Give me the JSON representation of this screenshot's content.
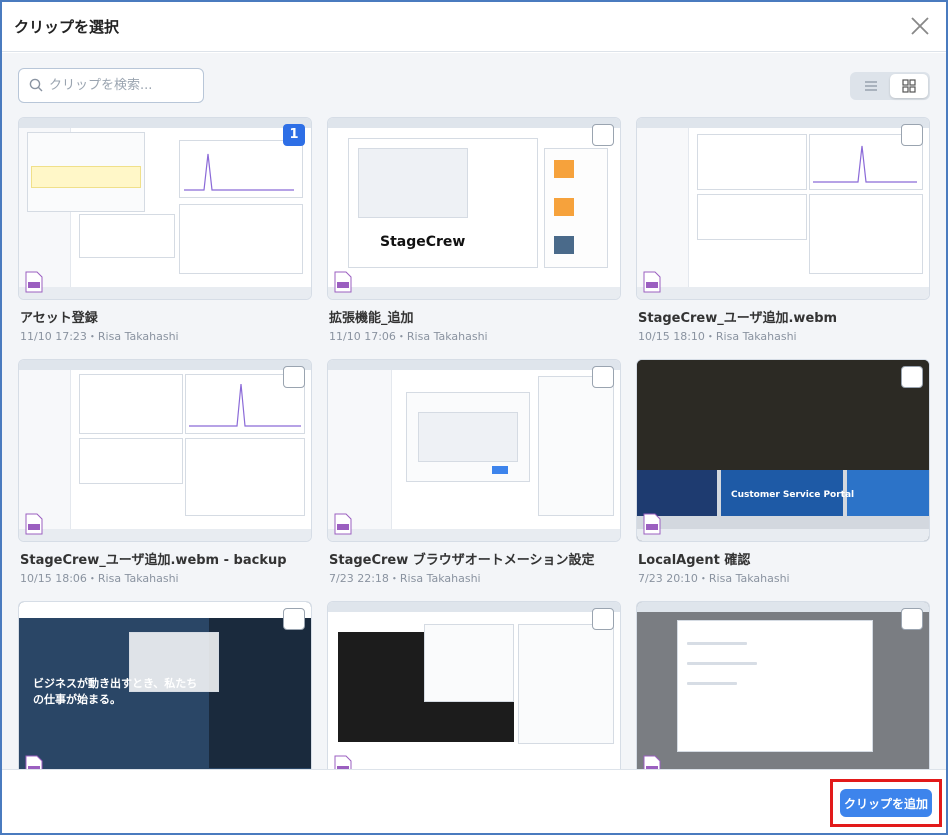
{
  "dialog": {
    "title": "クリップを選択",
    "close_icon": "close-icon"
  },
  "search": {
    "placeholder": "クリップを検索..."
  },
  "view_toggle": {
    "options": [
      "list-view-icon",
      "grid-view-icon"
    ],
    "selected": "grid"
  },
  "clips": [
    {
      "title": "アセット登録",
      "meta": "11/10 17:23・Risa Takahashi",
      "selected_order": "1",
      "selected": true
    },
    {
      "title": "拡張機能_追加",
      "meta": "11/10 17:06・Risa Takahashi",
      "selected": false,
      "thumb_brand": "StageCrew"
    },
    {
      "title": "StageCrew_ユーザ追加.webm",
      "meta": "10/15 18:10・Risa Takahashi",
      "selected": false
    },
    {
      "title": "StageCrew_ユーザ追加.webm - backup",
      "meta": "10/15 18:06・Risa Takahashi",
      "selected": false
    },
    {
      "title": "StageCrew ブラウザオートメーション設定",
      "meta": "7/23 22:18・Risa Takahashi",
      "selected": false
    },
    {
      "title": "LocalAgent 確認",
      "meta": "7/23 20:10・Risa Takahashi",
      "selected": false,
      "thumb_banner": "Customer Service Portal"
    },
    {
      "title": "",
      "meta": "",
      "selected": false,
      "thumb_caption": "ビジネスが動き出すとき、私たちの仕事が始まる。"
    },
    {
      "title": "",
      "meta": "",
      "selected": false
    },
    {
      "title": "",
      "meta": "",
      "selected": false
    }
  ],
  "footer": {
    "add_button_label": "クリップを追加"
  },
  "colors": {
    "accent": "#3d84ec",
    "highlight": "#e21a1a",
    "badge": "#2e6fe6"
  }
}
